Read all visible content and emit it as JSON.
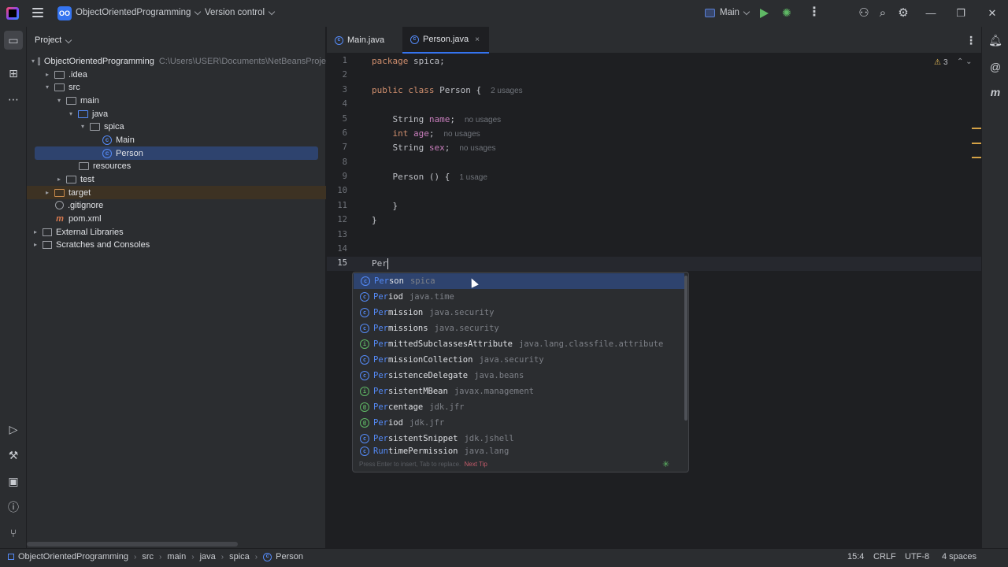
{
  "titlebar": {
    "project_badge": "OO",
    "project_name": "ObjectOrientedProgramming",
    "vcs_label": "Version control",
    "run_config": "Main"
  },
  "project_panel": {
    "header": "Project",
    "tree": [
      {
        "label": "ObjectOrientedProgramming",
        "path": "C:\\Users\\USER\\Documents\\NetBeansProje",
        "icon": "folder-icon",
        "arrow": "▾"
      },
      {
        "label": ".idea",
        "icon": "folder-icon",
        "arrow": "▸"
      },
      {
        "label": "src",
        "icon": "folder-icon",
        "arrow": "▾"
      },
      {
        "label": "main",
        "icon": "folder-icon",
        "arrow": "▾"
      },
      {
        "label": "java",
        "icon": "folder-icon",
        "arrow": "▾"
      },
      {
        "label": "spica",
        "icon": "package-icon",
        "arrow": "▾"
      },
      {
        "label": "Main",
        "icon": "class-icon",
        "arrow": ""
      },
      {
        "label": "Person",
        "icon": "class-icon",
        "arrow": ""
      },
      {
        "label": "resources",
        "icon": "folder-icon",
        "arrow": ""
      },
      {
        "label": "test",
        "icon": "folder-icon",
        "arrow": "▸"
      },
      {
        "label": "target",
        "icon": "folder-icon",
        "arrow": "▸"
      },
      {
        "label": ".gitignore",
        "icon": "gitignore-icon",
        "arrow": ""
      },
      {
        "label": "pom.xml",
        "icon": "maven-icon",
        "arrow": ""
      },
      {
        "label": "External Libraries",
        "icon": "library-icon",
        "arrow": "▸"
      },
      {
        "label": "Scratches and Consoles",
        "icon": "scratches-icon",
        "arrow": "▸"
      }
    ]
  },
  "tabs": [
    {
      "label": "Main.java"
    },
    {
      "label": "Person.java",
      "close": "×"
    }
  ],
  "editor": {
    "line_numbers": [
      "1",
      "2",
      "3",
      "4",
      "5",
      "6",
      "7",
      "8",
      "9",
      "10",
      "11",
      "12",
      "13",
      "14",
      "15"
    ],
    "warnings_count": "3",
    "hints": {
      "usages_2": "2 usages",
      "no_usages": "no usages",
      "usage_1": "1 usage"
    },
    "typed": "Per"
  },
  "completion": {
    "items": [
      {
        "icon": "c",
        "match": "Per",
        "rest": "son",
        "pkg": "spica"
      },
      {
        "icon": "c",
        "match": "Per",
        "rest": "iod",
        "pkg": "java.time"
      },
      {
        "icon": "c",
        "match": "Per",
        "rest": "mission",
        "pkg": "java.security"
      },
      {
        "icon": "c",
        "match": "Per",
        "rest": "missions",
        "pkg": "java.security"
      },
      {
        "icon": "i",
        "match": "Per",
        "rest": "mittedSubclassesAttribute",
        "pkg": "java.lang.classfile.attribute"
      },
      {
        "icon": "c",
        "match": "Per",
        "rest": "missionCollection",
        "pkg": "java.security"
      },
      {
        "icon": "c",
        "match": "Per",
        "rest": "sistenceDelegate",
        "pkg": "java.beans"
      },
      {
        "icon": "i",
        "match": "Per",
        "rest": "sistentMBean",
        "pkg": "javax.management"
      },
      {
        "icon": "a",
        "match": "Per",
        "rest": "centage",
        "pkg": "jdk.jfr"
      },
      {
        "icon": "a",
        "match": "Per",
        "rest": "iod",
        "pkg": "jdk.jfr"
      },
      {
        "icon": "c",
        "match": "Per",
        "rest": "sistentSnippet",
        "pkg": "jdk.jshell"
      },
      {
        "icon": "c",
        "match": "Run",
        "rest": "timePermission",
        "pkg": "java.lang"
      }
    ],
    "footer": "Press Enter to insert, Tab to replace.",
    "next_tip": "Next Tip"
  },
  "statusbar": {
    "breadcrumbs": [
      "ObjectOrientedProgramming",
      "src",
      "main",
      "java",
      "spica",
      "Person"
    ],
    "position": "15:4",
    "line_sep": "CRLF",
    "encoding": "UTF-8",
    "indent": "4 spaces"
  },
  "colors": {
    "accent": "#3574f0",
    "keyword": "#cf8e6d",
    "field": "#c77dbb",
    "selection": "#2e436e"
  }
}
